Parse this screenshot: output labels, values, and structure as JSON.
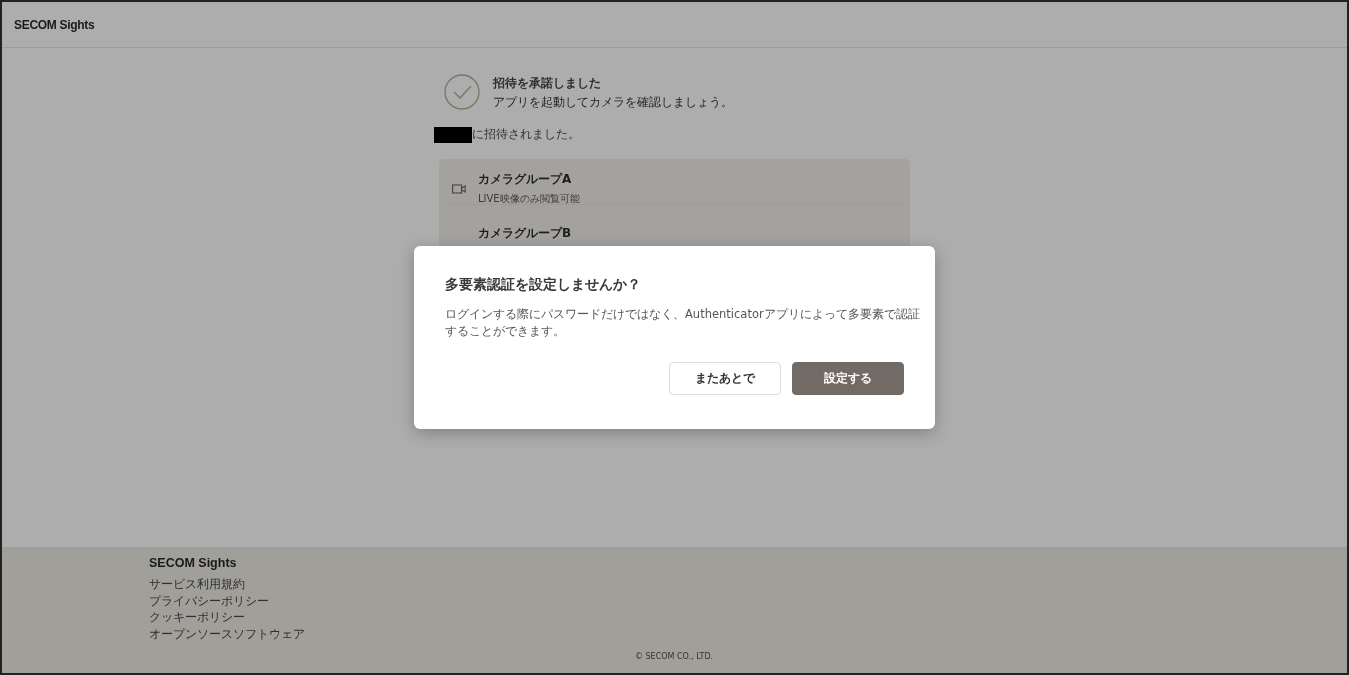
{
  "header": {
    "logo": "SECOM Sights"
  },
  "status": {
    "title": "招待を承諾しました",
    "subtitle": "アプリを起動してカメラを確認しましょう。"
  },
  "invite": {
    "message": "に招待されました。"
  },
  "camera_groups": [
    {
      "name": "カメラグループA",
      "permission": "LIVE映像のみ閲覧可能"
    },
    {
      "name": "カメラグループB"
    }
  ],
  "dialog": {
    "title": "多要素認証を設定しませんか？",
    "body": "ログインする際にパスワードだけではなく、Authenticatorアプリによって多要素で認証することができます。",
    "buttons": [
      {
        "label": "またあとで",
        "kind": "secondary"
      },
      {
        "label": "設定する",
        "kind": "primary"
      }
    ]
  },
  "footer": {
    "logo": "SECOM Sights",
    "links": [
      "サービス利用規約",
      "プライバシーポリシー",
      "クッキーポリシー",
      "オープンソースソフトウェア"
    ],
    "copyright": "© SECOM CO., LTD."
  }
}
